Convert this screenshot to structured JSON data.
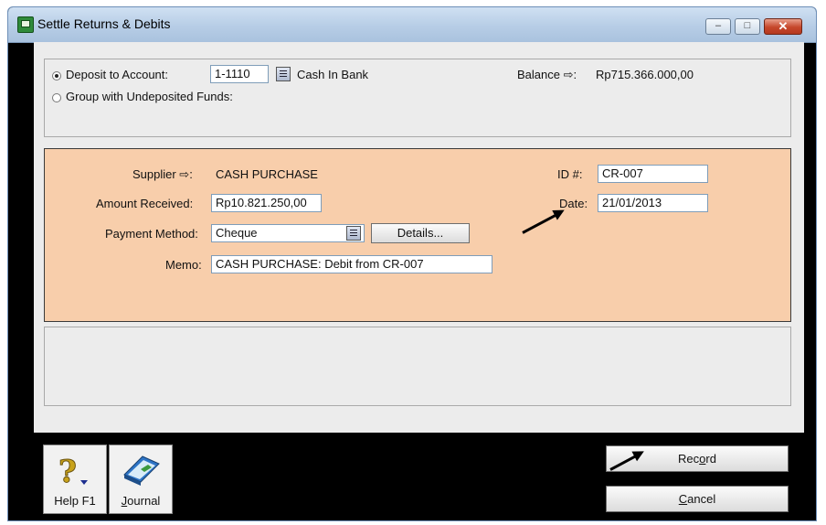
{
  "window": {
    "title": "Settle Returns & Debits",
    "controls": {
      "minimize": "–",
      "maximize": "□",
      "close": "✕"
    }
  },
  "deposit": {
    "deposit_option_label": "Deposit to Account:",
    "account_number": "1-1110",
    "account_name": "Cash In Bank",
    "balance_label": "Balance ⇨:",
    "balance_value": "Rp715.366.000,00",
    "group_option_label": "Group with Undeposited Funds:"
  },
  "payment": {
    "supplier_label": "Supplier ⇨:",
    "supplier_value": "CASH PURCHASE",
    "id_label": "ID #:",
    "id_value": "CR-007",
    "amount_label": "Amount Received:",
    "amount_value": "Rp10.821.250,00",
    "date_label": "Date:",
    "date_value": "21/01/2013",
    "method_label": "Payment Method:",
    "method_value": "Cheque",
    "details_label": "Details...",
    "memo_label": "Memo:",
    "memo_value": "CASH PURCHASE:  Debit from CR-007"
  },
  "footer": {
    "help_label": "Help F1",
    "journal_label": "Journal",
    "record_label": "Record",
    "cancel_label": "Cancel"
  },
  "colors": {
    "form_background": "#f8ceab",
    "window_background": "#000000",
    "titlebar": "#b7cde6",
    "close_button": "#c6472b"
  },
  "icons": {
    "help": "question-mark-icon",
    "journal": "journal-book-icon",
    "supplier_detail": "arrow-right-icon",
    "balance_detail": "arrow-right-icon"
  }
}
